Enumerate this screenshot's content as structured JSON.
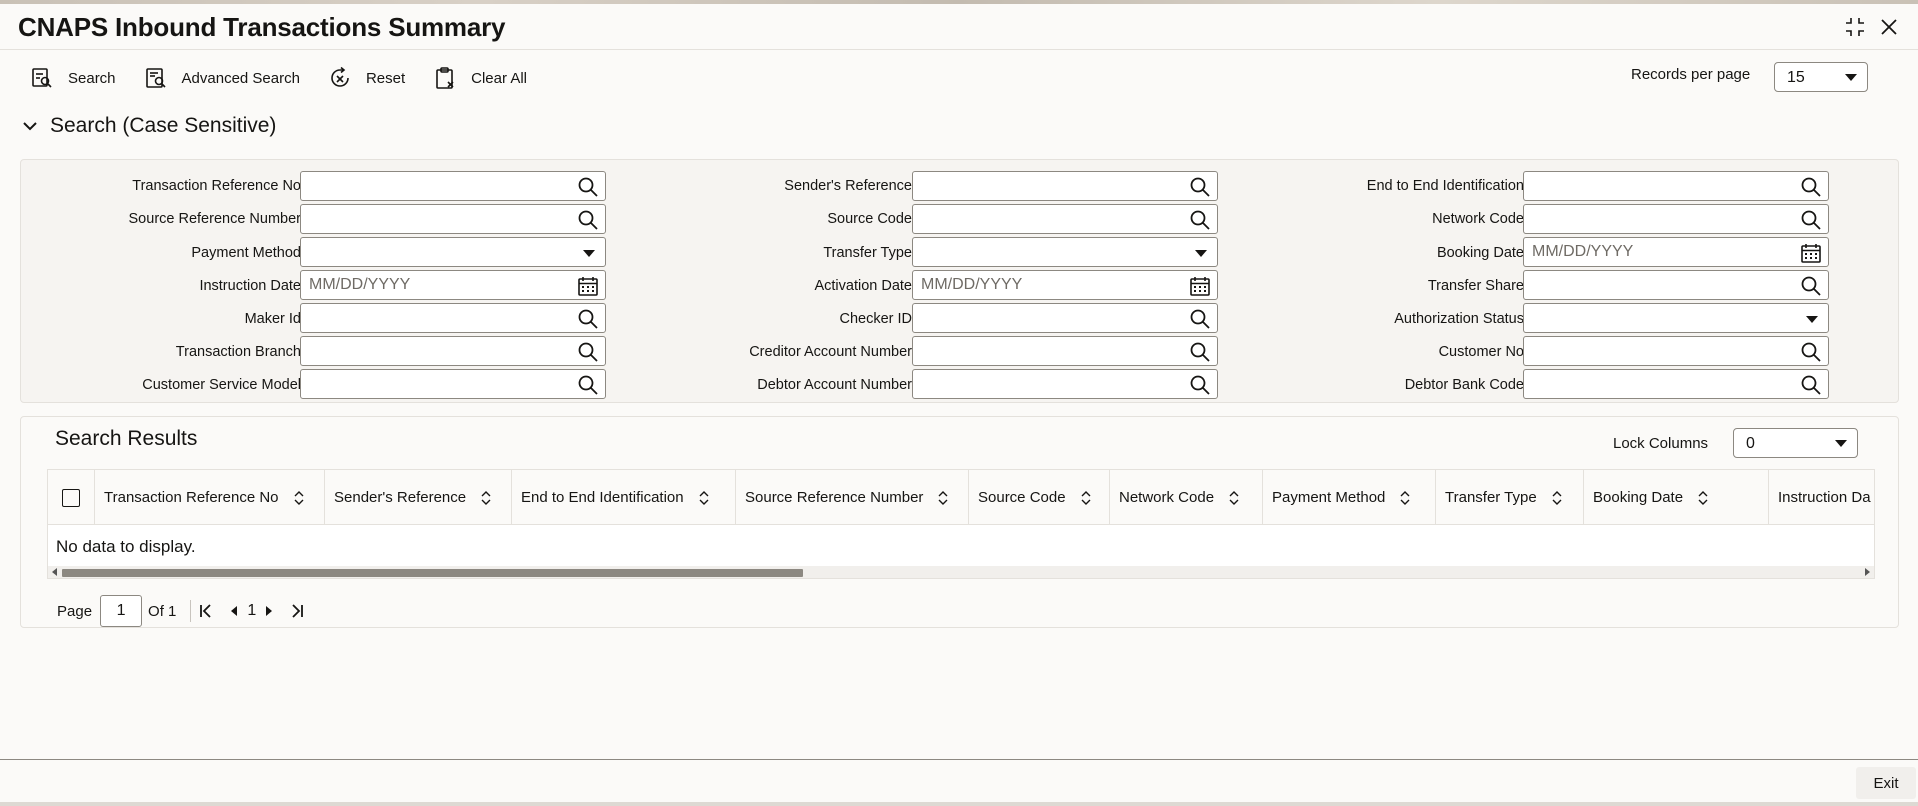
{
  "window": {
    "title": "CNAPS Inbound Transactions Summary"
  },
  "toolbar": {
    "search_label": "Search",
    "advanced_search_label": "Advanced Search",
    "reset_label": "Reset",
    "clear_all_label": "Clear All"
  },
  "records_per_page": {
    "label": "Records per page",
    "value": "15"
  },
  "search_section": {
    "title": "Search (Case Sensitive)",
    "fields": {
      "transaction_reference_no": {
        "label": "Transaction Reference No",
        "value": ""
      },
      "senders_reference": {
        "label": "Sender's Reference",
        "value": ""
      },
      "end_to_end_identification": {
        "label": "End to End Identification",
        "value": ""
      },
      "source_reference_number": {
        "label": "Source Reference Number",
        "value": ""
      },
      "source_code": {
        "label": "Source Code",
        "value": ""
      },
      "network_code": {
        "label": "Network Code",
        "value": ""
      },
      "payment_method": {
        "label": "Payment Method",
        "value": ""
      },
      "transfer_type": {
        "label": "Transfer Type",
        "value": ""
      },
      "booking_date": {
        "label": "Booking Date",
        "value": "",
        "placeholder": "MM/DD/YYYY"
      },
      "instruction_date": {
        "label": "Instruction Date",
        "value": "",
        "placeholder": "MM/DD/YYYY"
      },
      "activation_date": {
        "label": "Activation Date",
        "value": "",
        "placeholder": "MM/DD/YYYY"
      },
      "transfer_share": {
        "label": "Transfer Share",
        "value": ""
      },
      "maker_id": {
        "label": "Maker Id",
        "value": ""
      },
      "checker_id": {
        "label": "Checker ID",
        "value": ""
      },
      "authorization_status": {
        "label": "Authorization Status",
        "value": ""
      },
      "transaction_branch": {
        "label": "Transaction Branch",
        "value": ""
      },
      "creditor_account_number": {
        "label": "Creditor Account Number",
        "value": ""
      },
      "customer_no": {
        "label": "Customer No",
        "value": ""
      },
      "customer_service_model": {
        "label": "Customer Service Model",
        "value": ""
      },
      "debtor_account_number": {
        "label": "Debtor Account Number",
        "value": ""
      },
      "debtor_bank_code": {
        "label": "Debtor Bank Code",
        "value": ""
      }
    }
  },
  "results": {
    "title": "Search Results",
    "lock_columns_label": "Lock Columns",
    "lock_columns_value": "0",
    "columns": [
      "Transaction Reference No",
      "Sender's Reference",
      "End to End Identification",
      "Source Reference Number",
      "Source Code",
      "Network Code",
      "Payment Method",
      "Transfer Type",
      "Booking Date",
      "Instruction Da"
    ],
    "empty_message": "No data to display."
  },
  "pagination": {
    "page_label": "Page",
    "current_page": "1",
    "of_label": "Of 1",
    "page_link": "1"
  },
  "footer": {
    "exit_label": "Exit"
  },
  "colors": {
    "background": "#fbfaf8",
    "text": "#161513",
    "border": "#8c8881",
    "panel": "#f6f4f1"
  },
  "icons": {
    "maximize": "maximize-icon",
    "close": "close-icon",
    "search": "search-icon",
    "advanced_search": "advanced-search-icon",
    "reset": "reset-icon",
    "clear_all": "clear-all-icon",
    "collapse": "chevron-down-icon",
    "lookup": "magnifier-icon",
    "calendar": "calendar-icon",
    "sort": "sort-icon"
  }
}
